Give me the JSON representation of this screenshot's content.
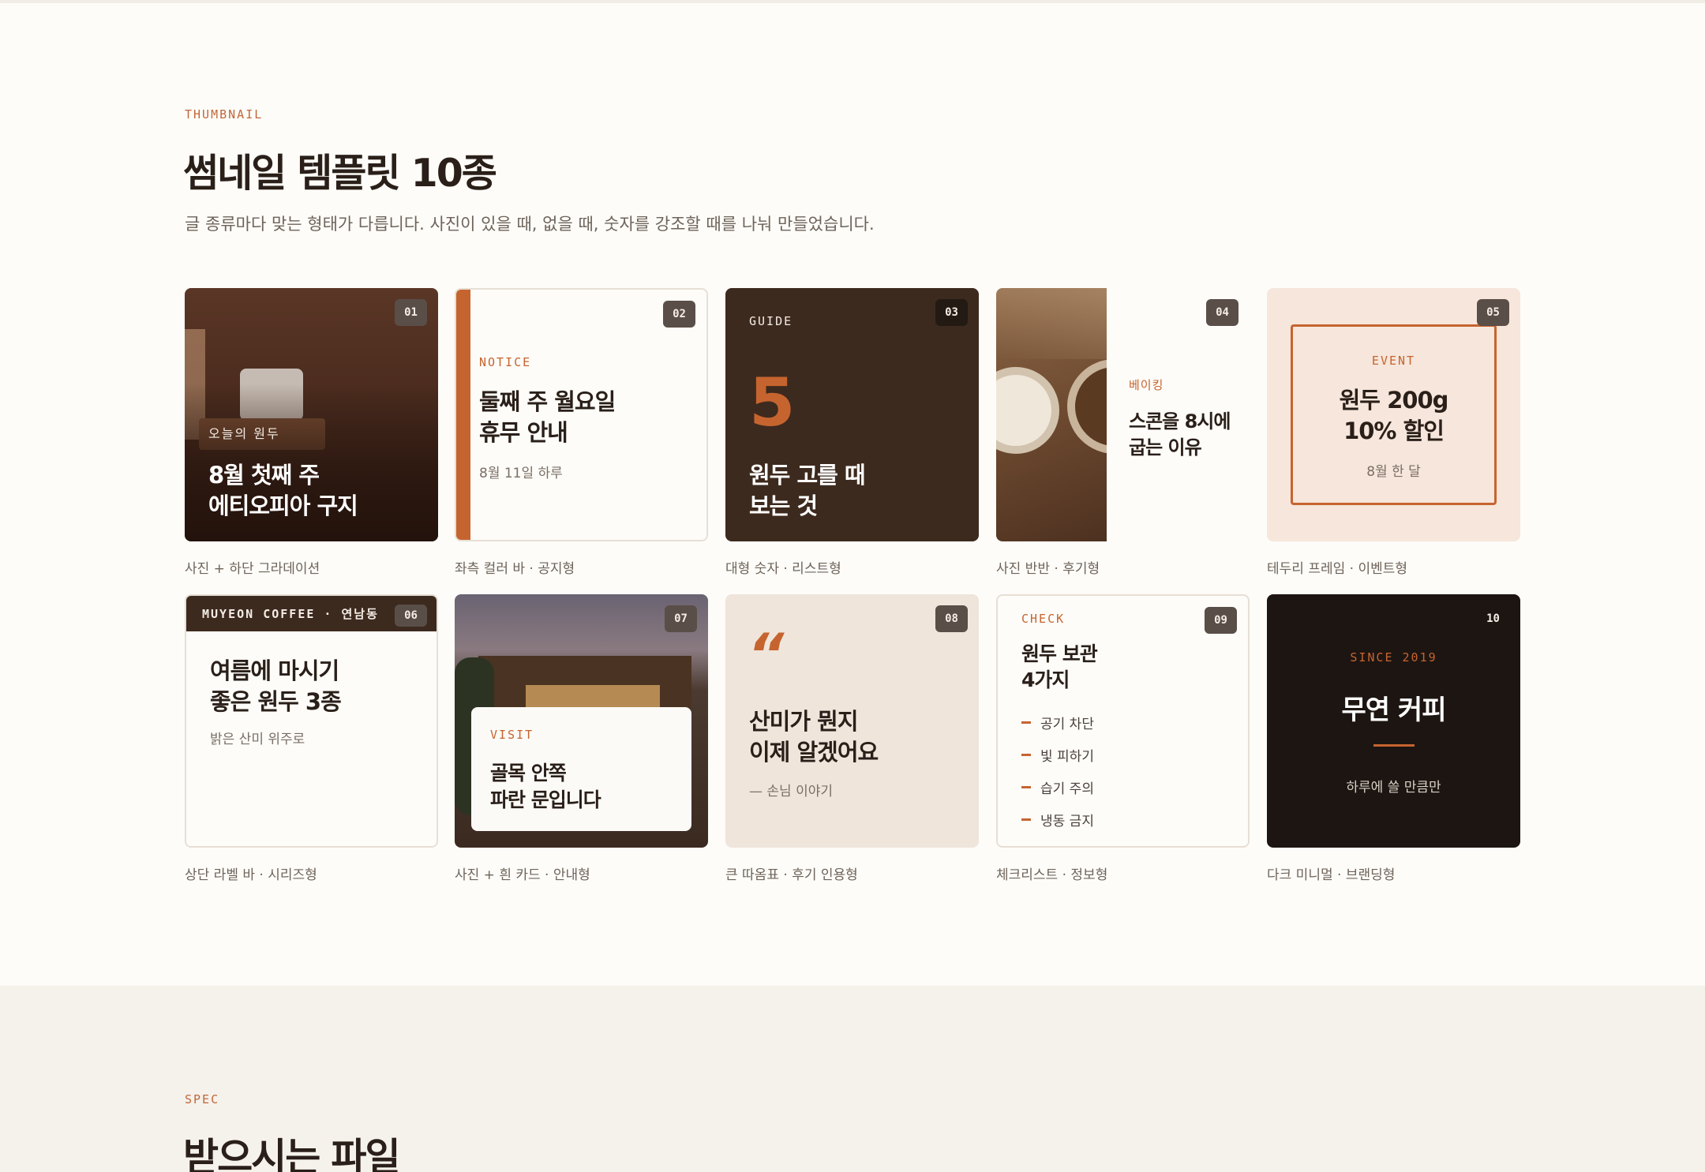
{
  "section1": {
    "eyebrow": "THUMBNAIL",
    "title": "썸네일 템플릿 10종",
    "lead": "글 종류마다 맞는 형태가 다릅니다. 사진이 있을 때, 없을 때, 숫자를 강조할 때를 나눠 만들었습니다."
  },
  "cards": [
    {
      "num": "01",
      "small": "오늘의 원두",
      "title1": "8월 첫째 주",
      "title2": "에티오피아 구지",
      "caption": "사진 + 하단 그라데이션"
    },
    {
      "num": "02",
      "small": "NOTICE",
      "title1": "둘째 주 월요일",
      "title2": "휴무 안내",
      "sub": "8월 11일 하루",
      "caption": "좌측 컬러 바 · 공지형"
    },
    {
      "num": "03",
      "small": "GUIDE",
      "big": "5",
      "title1": "원두 고를 때",
      "title2": "보는 것",
      "caption": "대형 숫자 · 리스트형"
    },
    {
      "num": "04",
      "small": "베이킹",
      "title1": "스콘을 8시에",
      "title2": "굽는 이유",
      "caption": "사진 반반 · 후기형"
    },
    {
      "num": "05",
      "small": "EVENT",
      "title1": "원두 200g",
      "title2": "10% 할인",
      "sub": "8월 한 달",
      "caption": "테두리 프레임 · 이벤트형"
    },
    {
      "num": "06",
      "small": "MUYEON COFFEE · 연남동",
      "title1": "여름에 마시기",
      "title2": "좋은 원두 3종",
      "sub": "밝은 산미 위주로",
      "caption": "상단 라벨 바 · 시리즈형"
    },
    {
      "num": "07",
      "small": "VISIT",
      "title1": "골목 안쪽",
      "title2": "파란 문입니다",
      "caption": "사진 + 흰 카드 · 안내형"
    },
    {
      "num": "08",
      "quote": "“",
      "title1": "산미가 뭔지",
      "title2": "이제 알겠어요",
      "sub": "— 손님 이야기",
      "caption": "큰 따옴표 · 후기 인용형"
    },
    {
      "num": "09",
      "small": "CHECK",
      "title1": "원두 보관",
      "title2": "4가지",
      "items": [
        "공기 차단",
        "빛 피하기",
        "습기 주의",
        "냉동 금지"
      ],
      "caption": "체크리스트 · 정보형"
    },
    {
      "num": "10",
      "small": "SINCE 2019",
      "title1": "무연 커피",
      "sub": "하루에 쓸 만큼만",
      "caption": "다크 미니멀 · 브랜딩형"
    }
  ],
  "section2": {
    "eyebrow": "SPEC",
    "title": "받으시는 파일"
  },
  "colors": {
    "accent": "#c6642f",
    "dark": "#3d2a1e",
    "bg": "#fdfcf8"
  }
}
